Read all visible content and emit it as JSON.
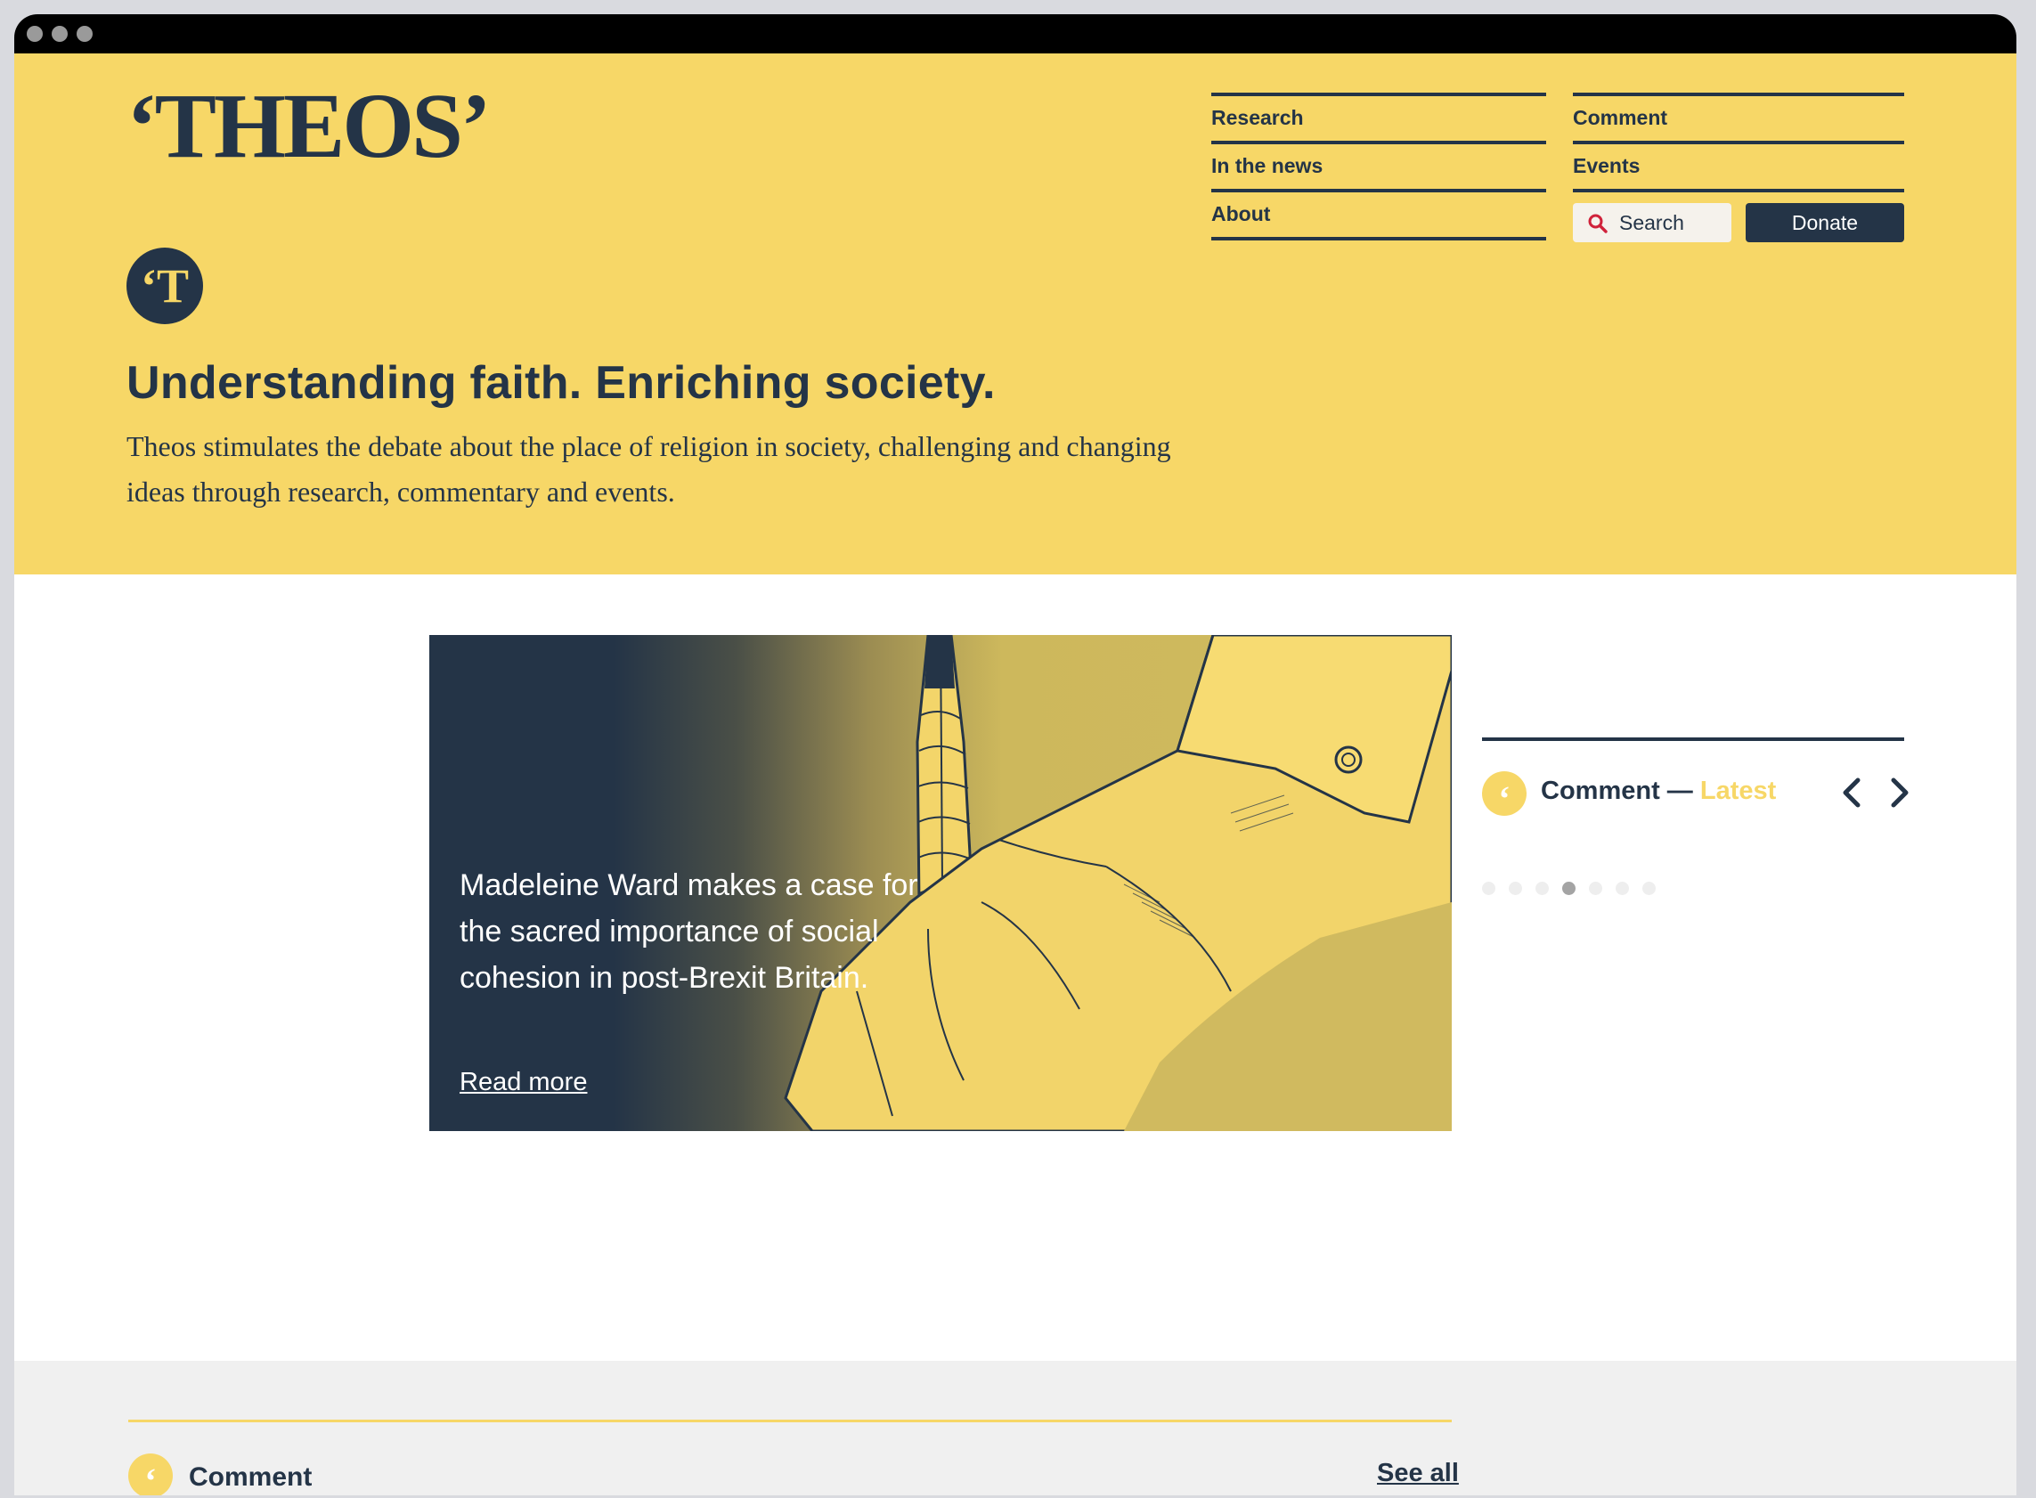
{
  "window": {
    "title_dots": 3
  },
  "header": {
    "logo": "‘THEOS’",
    "nav_left": [
      "Research",
      "In the news",
      "About"
    ],
    "nav_right": [
      "Comment",
      "Events"
    ],
    "search_label": "Search",
    "donate_label": "Donate",
    "badge_letter": "‘T"
  },
  "hero": {
    "tagline": "Understanding faith. Enriching society.",
    "intro": "Theos stimulates the debate about the place of religion in society, challenging and changing ideas through research, commentary and events."
  },
  "feature": {
    "text": "Madeleine Ward makes a case for the sacred importance of social cohesion in post-Brexit Britain.",
    "read_more": "Read more"
  },
  "carousel": {
    "section": "Comment —",
    "highlight": "Latest",
    "quote_glyph": "‘",
    "dots_total": 7,
    "active_dot": 4
  },
  "footer": {
    "section_label": "Comment",
    "see_all": "See all"
  },
  "colors": {
    "brand_yellow": "#f7d767",
    "navy": "#243447",
    "search_icon": "#d0223a"
  }
}
